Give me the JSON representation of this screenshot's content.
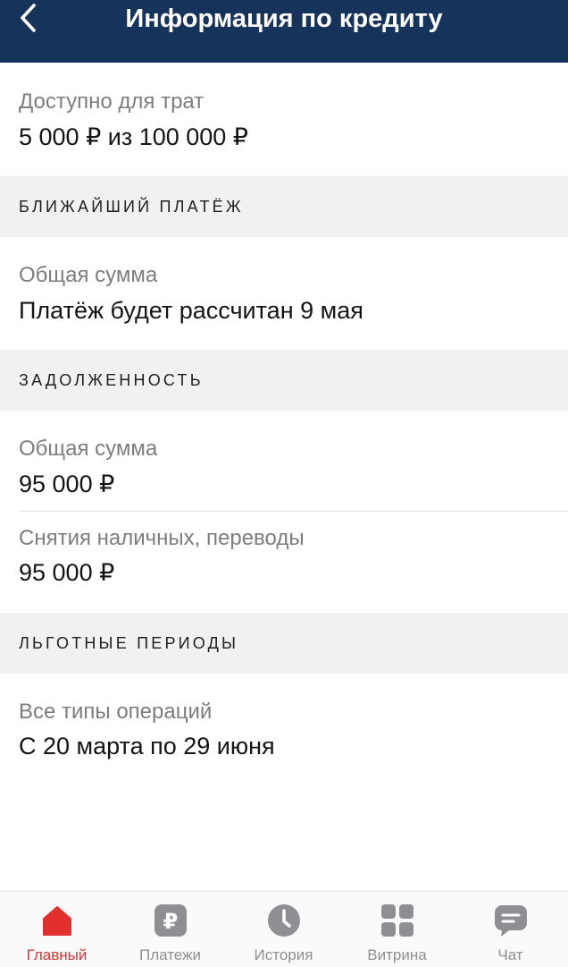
{
  "header": {
    "title": "Информация по кредиту",
    "back_icon": "chevron-left-icon"
  },
  "available": {
    "label": "Доступно для трат",
    "value": "5 000 ₽ из 100 000 ₽"
  },
  "next_payment": {
    "section_title": "БЛИЖАЙШИЙ ПЛАТЁЖ",
    "label": "Общая сумма",
    "value": "Платёж будет рассчитан 9 мая"
  },
  "debt": {
    "section_title": "ЗАДОЛЖЕННОСТЬ",
    "total_label": "Общая сумма",
    "total_value": "95 000 ₽",
    "cash_label": "Снятия наличных, переводы",
    "cash_value": "95 000 ₽"
  },
  "grace": {
    "section_title": "ЛЬГОТНЫЕ ПЕРИОДЫ",
    "label": "Все типы операций",
    "value": "С 20 марта по 29 июня"
  },
  "tabbar": {
    "active_color": "#e2302f",
    "inactive_color": "#8e8e93",
    "items": [
      {
        "label": "Главный",
        "icon": "home-icon",
        "active": true
      },
      {
        "label": "Платежи",
        "icon": "ruble-icon",
        "active": false
      },
      {
        "label": "История",
        "icon": "clock-icon",
        "active": false
      },
      {
        "label": "Витрина",
        "icon": "grid-icon",
        "active": false
      },
      {
        "label": "Чат",
        "icon": "chat-icon",
        "active": false
      }
    ]
  }
}
